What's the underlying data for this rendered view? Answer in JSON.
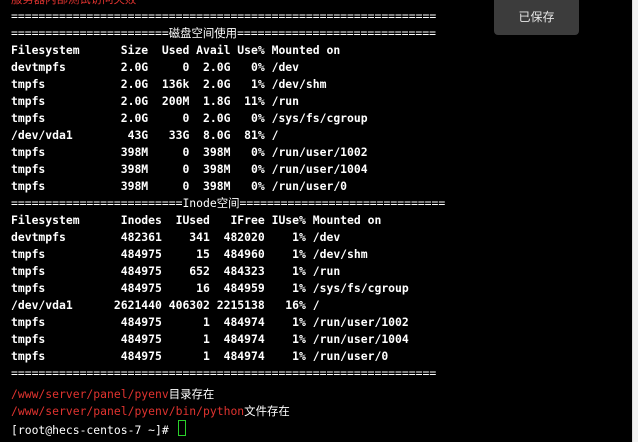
{
  "toolbar": {
    "saved_label": "已保存"
  },
  "colors": {
    "path_red": "#e0332f",
    "cursor_green": "#2bd12b",
    "terminal_bg": "#000000"
  },
  "terminal": {
    "lines": [
      {
        "text": "服务器内部测试访问失败",
        "style": "red"
      },
      {
        "text": "==============================================================",
        "style": ""
      },
      {
        "text": "=======================磁盘空间使用=============================",
        "style": ""
      },
      {
        "text": "Filesystem      Size  Used Avail Use% Mounted on",
        "style": "hdr"
      },
      {
        "text": "devtmpfs        2.0G     0  2.0G   0% /dev",
        "style": "hdr"
      },
      {
        "text": "tmpfs           2.0G  136k  2.0G   1% /dev/shm",
        "style": "hdr"
      },
      {
        "text": "tmpfs           2.0G  200M  1.8G  11% /run",
        "style": "hdr"
      },
      {
        "text": "tmpfs           2.0G     0  2.0G   0% /sys/fs/cgroup",
        "style": "hdr"
      },
      {
        "text": "/dev/vda1        43G   33G  8.0G  81% /",
        "style": "hdr"
      },
      {
        "text": "tmpfs           398M     0  398M   0% /run/user/1002",
        "style": "hdr"
      },
      {
        "text": "tmpfs           398M     0  398M   0% /run/user/1004",
        "style": "hdr"
      },
      {
        "text": "tmpfs           398M     0  398M   0% /run/user/0",
        "style": "hdr"
      },
      {
        "text": "=========================Inode空间==============================",
        "style": ""
      },
      {
        "text": "Filesystem      Inodes  IUsed   IFree IUse% Mounted on",
        "style": "hdr"
      },
      {
        "text": "devtmpfs        482361    341  482020    1% /dev",
        "style": "hdr"
      },
      {
        "text": "tmpfs           484975     15  484960    1% /dev/shm",
        "style": "hdr"
      },
      {
        "text": "tmpfs           484975    652  484323    1% /run",
        "style": "hdr"
      },
      {
        "text": "tmpfs           484975     16  484959    1% /sys/fs/cgroup",
        "style": "hdr"
      },
      {
        "text": "/dev/vda1      2621440 406302 2215138   16% /",
        "style": "hdr"
      },
      {
        "text": "tmpfs           484975      1  484974    1% /run/user/1002",
        "style": "hdr"
      },
      {
        "text": "tmpfs           484975      1  484974    1% /run/user/1004",
        "style": "hdr"
      },
      {
        "text": "tmpfs           484975      1  484974    1% /run/user/0",
        "style": "hdr"
      },
      {
        "text": "==============================================================",
        "style": ""
      }
    ],
    "path_lines": [
      {
        "path": "/www/server/panel/pyenv",
        "suffix": "目录存在"
      },
      {
        "path": "/www/server/panel/pyenv/bin/python",
        "suffix": "文件存在"
      }
    ],
    "prompt": "[root@hecs-centos-7 ~]# "
  }
}
